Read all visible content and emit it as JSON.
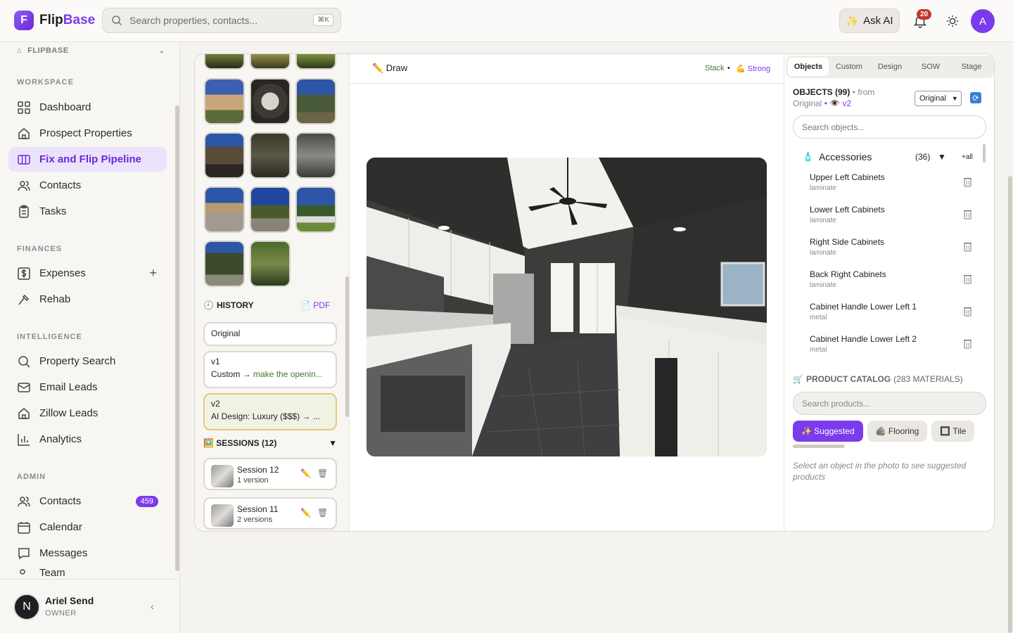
{
  "app": {
    "name_main": "Flip",
    "name_accent": "Base",
    "logo_letter": "F"
  },
  "search": {
    "placeholder": "Search properties, contacts...",
    "shortcut": "⌘K"
  },
  "topbar": {
    "ask_ai": "Ask AI",
    "notifications": "20",
    "avatar": "A"
  },
  "sidebar": {
    "workspace": "FLIPBASE",
    "sections": {
      "workspace": "WORKSPACE",
      "finances": "FINANCES",
      "intelligence": "INTELLIGENCE",
      "admin": "ADMIN"
    },
    "items": {
      "dashboard": "Dashboard",
      "prospect": "Prospect Properties",
      "pipeline": "Fix and Flip Pipeline",
      "contacts": "Contacts",
      "tasks": "Tasks",
      "expenses": "Expenses",
      "rehab": "Rehab",
      "property_search": "Property Search",
      "email_leads": "Email Leads",
      "zillow_leads": "Zillow Leads",
      "analytics": "Analytics",
      "admin_contacts": "Contacts",
      "admin_contacts_count": "459",
      "calendar": "Calendar",
      "messages": "Messages",
      "team": "Team"
    },
    "user": {
      "initial": "N",
      "name": "Ariel Send",
      "role": "OWNER"
    }
  },
  "history": {
    "title": "HISTORY",
    "pdf": "PDF",
    "versions": [
      {
        "label": "Original"
      },
      {
        "label": "v1",
        "prefix": "Custom → ",
        "detail": "make the openin..."
      },
      {
        "label": "v2",
        "detail": "AI Design: Luxury ($$$) → ..."
      }
    ]
  },
  "sessions": {
    "title": "SESSIONS (12)",
    "items": [
      {
        "name": "Session 12",
        "versions": "1 version"
      },
      {
        "name": "Session 11",
        "versions": "2 versions"
      }
    ]
  },
  "canvas": {
    "draw": "✏️ Draw",
    "stack": "Stack",
    "separator": "•",
    "strong": "💪 Strong"
  },
  "panel": {
    "tabs": [
      "Objects",
      "Custom",
      "Design",
      "SOW",
      "Stage"
    ],
    "objects_title": "OBJECTS (99)",
    "from": "• from",
    "source": "Original",
    "version_tag": "• 👁️ v2",
    "select_value": "Original",
    "search_placeholder": "Search objects...",
    "category": {
      "name": "Accessories",
      "count": "(36)",
      "arrow": "▼",
      "all": "+all"
    },
    "items": [
      {
        "name": "Upper Left Cabinets",
        "material": "laminate"
      },
      {
        "name": "Lower Left Cabinets",
        "material": "laminate"
      },
      {
        "name": "Right Side Cabinets",
        "material": "laminate"
      },
      {
        "name": "Back Right Cabinets",
        "material": "laminate"
      },
      {
        "name": "Cabinet Handle Lower Left 1",
        "material": "metal"
      },
      {
        "name": "Cabinet Handle Lower Left 2",
        "material": "metal"
      }
    ],
    "catalog_title": "PRODUCT CATALOG",
    "catalog_count": "(283 MATERIALS)",
    "product_placeholder": "Search products...",
    "chips": [
      "✨ Suggested",
      "🪨 Flooring",
      "🔲 Tile"
    ],
    "hint": "Select an object in the photo to see suggested products"
  }
}
